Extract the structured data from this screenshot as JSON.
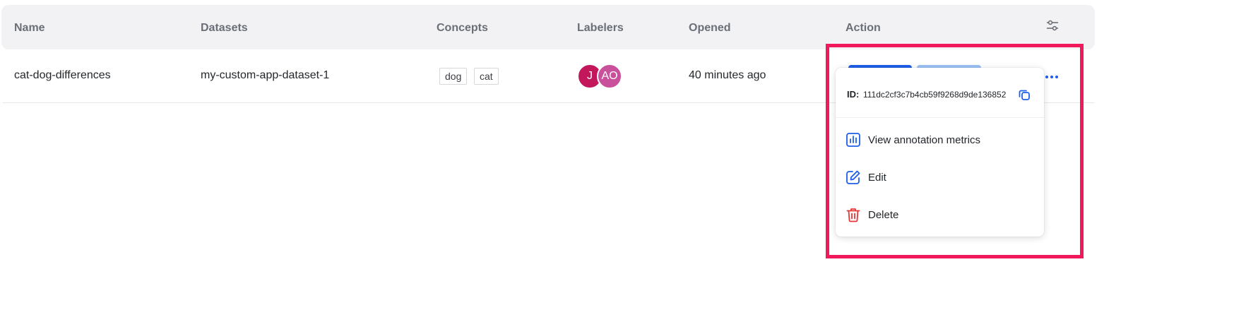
{
  "table": {
    "columns": [
      "Name",
      "Datasets",
      "Concepts",
      "Labelers",
      "Opened",
      "Action"
    ],
    "rows": [
      {
        "name": "cat-dog-differences",
        "dataset": "my-custom-app-dataset-1",
        "concepts": [
          "dog",
          "cat"
        ],
        "labelers": [
          {
            "initials": "J",
            "color": "#c2185b"
          },
          {
            "initials": "AO",
            "color": "#c9509a"
          }
        ],
        "opened": "40 minutes ago"
      }
    ]
  },
  "action_menu": {
    "id_label": "ID:",
    "id_value": "111dc2cf3c7b4cb59f9268d9de136852",
    "items": [
      {
        "label": "View annotation metrics",
        "icon": "bar-chart-icon"
      },
      {
        "label": "Edit",
        "icon": "edit-icon"
      },
      {
        "label": "Delete",
        "icon": "trash-icon"
      }
    ]
  },
  "colors": {
    "accent": "#1e5ee8",
    "danger": "#e53935",
    "highlight": "#f2185c"
  }
}
